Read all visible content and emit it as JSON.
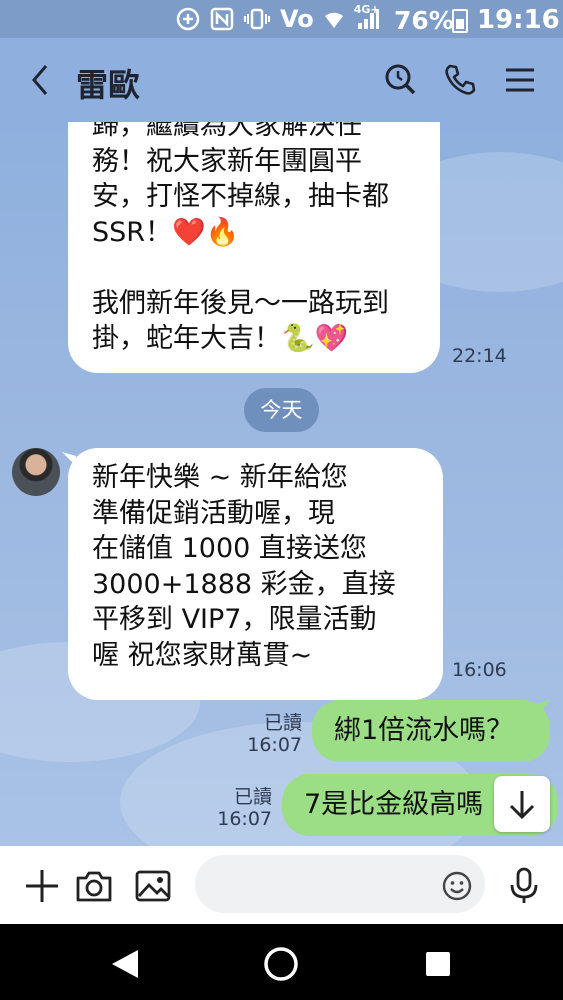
{
  "status_bar": {
    "network": "Vo",
    "network_type": "4G+",
    "battery": "76%",
    "time": "19:16"
  },
  "header": {
    "contact_name": "雷歐",
    "icons": [
      "back-icon",
      "search-icon",
      "phone-icon",
      "menu-icon"
    ]
  },
  "messages": {
    "m1": {
      "lines": [
        "歸，繼續為大家解決任",
        "務！祝大家新年團圓平",
        "安，打怪不掉線，抽卡都",
        "SSR！❤️🔥",
        "",
        "我們新年後見～一路玩到",
        "掛，蛇年大吉！🐍💖"
      ],
      "time": "22:14"
    },
    "date_divider": "今天",
    "m2": {
      "lines": [
        "新年快樂 ~ 新年給您",
        "準備促銷活動喔，現",
        "在儲值 1000 直接送您",
        "3000+1888 彩金，直接",
        "平移到 VIP7，限量活動",
        "喔  祝您家財萬貫~"
      ],
      "time": "16:06"
    },
    "m3": {
      "text": "綁1倍流水嗎？",
      "read": "已讀",
      "time": "16:07"
    },
    "m4": {
      "text": "7是比金級高嗎",
      "read": "已讀",
      "time": "16:07"
    }
  },
  "input_bar": {
    "placeholder": "",
    "icons": [
      "plus-icon",
      "camera-icon",
      "image-icon",
      "emoji-icon",
      "mic-icon"
    ]
  },
  "colors": {
    "chat_bg": "#8fb0de",
    "outgoing_bubble": "#9bde86",
    "incoming_bubble": "#ffffff",
    "date_pill": "#6f8fbd"
  }
}
